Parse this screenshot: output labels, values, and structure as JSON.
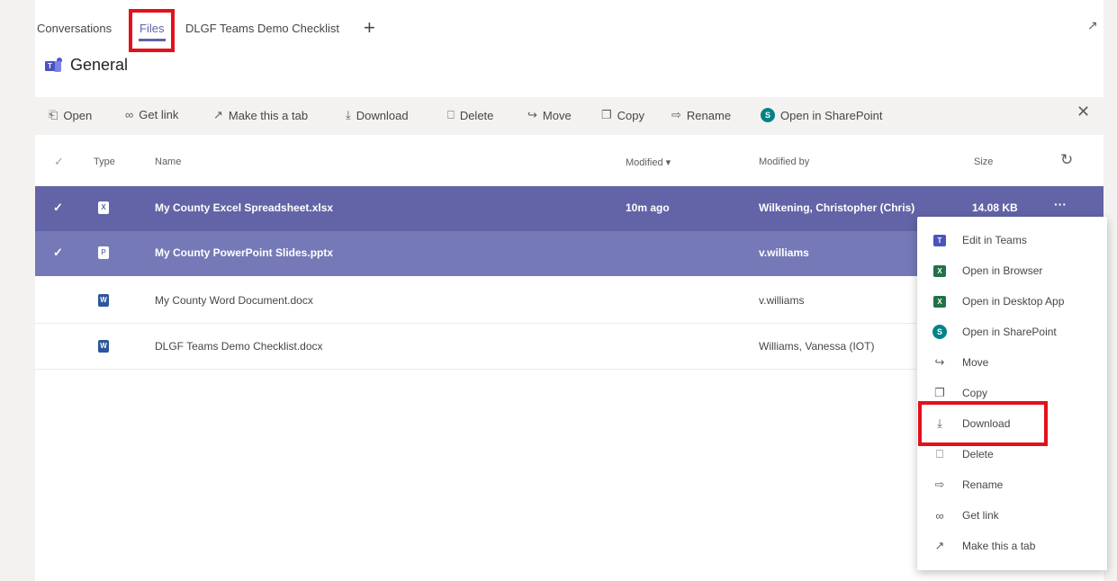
{
  "tabs": [
    {
      "label": "Conversations"
    },
    {
      "label": "Files"
    },
    {
      "label": "DLGF Teams Demo Checklist"
    }
  ],
  "add_tab_icon": "plus-icon",
  "channel_name": "General",
  "toolbar": {
    "items": [
      {
        "label": "Open",
        "icon": "open-icon"
      },
      {
        "label": "Get link",
        "icon": "link-icon"
      },
      {
        "label": "Make this a tab",
        "icon": "tab-icon"
      },
      {
        "label": "Download",
        "icon": "download-icon"
      },
      {
        "label": "Delete",
        "icon": "delete-icon"
      },
      {
        "label": "Move",
        "icon": "move-icon"
      },
      {
        "label": "Copy",
        "icon": "copy-icon"
      },
      {
        "label": "Rename",
        "icon": "rename-icon"
      },
      {
        "label": "Open in SharePoint",
        "icon": "sharepoint-icon"
      }
    ]
  },
  "columns": {
    "type": "Type",
    "name": "Name",
    "modified": "Modified ▾",
    "modified_by": "Modified by",
    "size": "Size"
  },
  "files": [
    {
      "name": "My County Excel Spreadsheet.xlsx",
      "modified": "10m ago",
      "modified_by": "Wilkening, Christopher (Chris)",
      "size": "14.08 KB",
      "app_color": "#d0d3ec",
      "selected": true
    },
    {
      "name": "My County PowerPoint Slides.pptx",
      "modified": "",
      "modified_by": "v.williams",
      "size": "",
      "app_color": "#d0d3ec",
      "selected": true
    },
    {
      "name": "My County Word Document.docx",
      "modified": "",
      "modified_by": "v.williams",
      "size": "",
      "app_color": "#2b579a",
      "selected": false
    },
    {
      "name": "DLGF Teams Demo Checklist.docx",
      "modified": "",
      "modified_by": "Williams, Vanessa (IOT)",
      "size": "",
      "app_color": "#2b579a",
      "selected": false
    }
  ],
  "more_label": "···",
  "context_menu": [
    {
      "label": "Edit in Teams",
      "icon": "teams-icon"
    },
    {
      "label": "Open in Browser",
      "icon": "excel-icon"
    },
    {
      "label": "Open in Desktop App",
      "icon": "excel-icon"
    },
    {
      "label": "Open in SharePoint",
      "icon": "sharepoint-icon"
    },
    {
      "label": "Move",
      "icon": "move-icon"
    },
    {
      "label": "Copy",
      "icon": "copy-icon"
    },
    {
      "label": "Download",
      "icon": "download-icon"
    },
    {
      "label": "Delete",
      "icon": "delete-icon"
    },
    {
      "label": "Rename",
      "icon": "rename-icon"
    },
    {
      "label": "Get link",
      "icon": "link-icon"
    },
    {
      "label": "Make this a tab",
      "icon": "tab-icon"
    }
  ],
  "colors": {
    "accent": "#6264a7",
    "highlight": "#e3111b",
    "excel": "#217346",
    "sharepoint": "#038387"
  }
}
